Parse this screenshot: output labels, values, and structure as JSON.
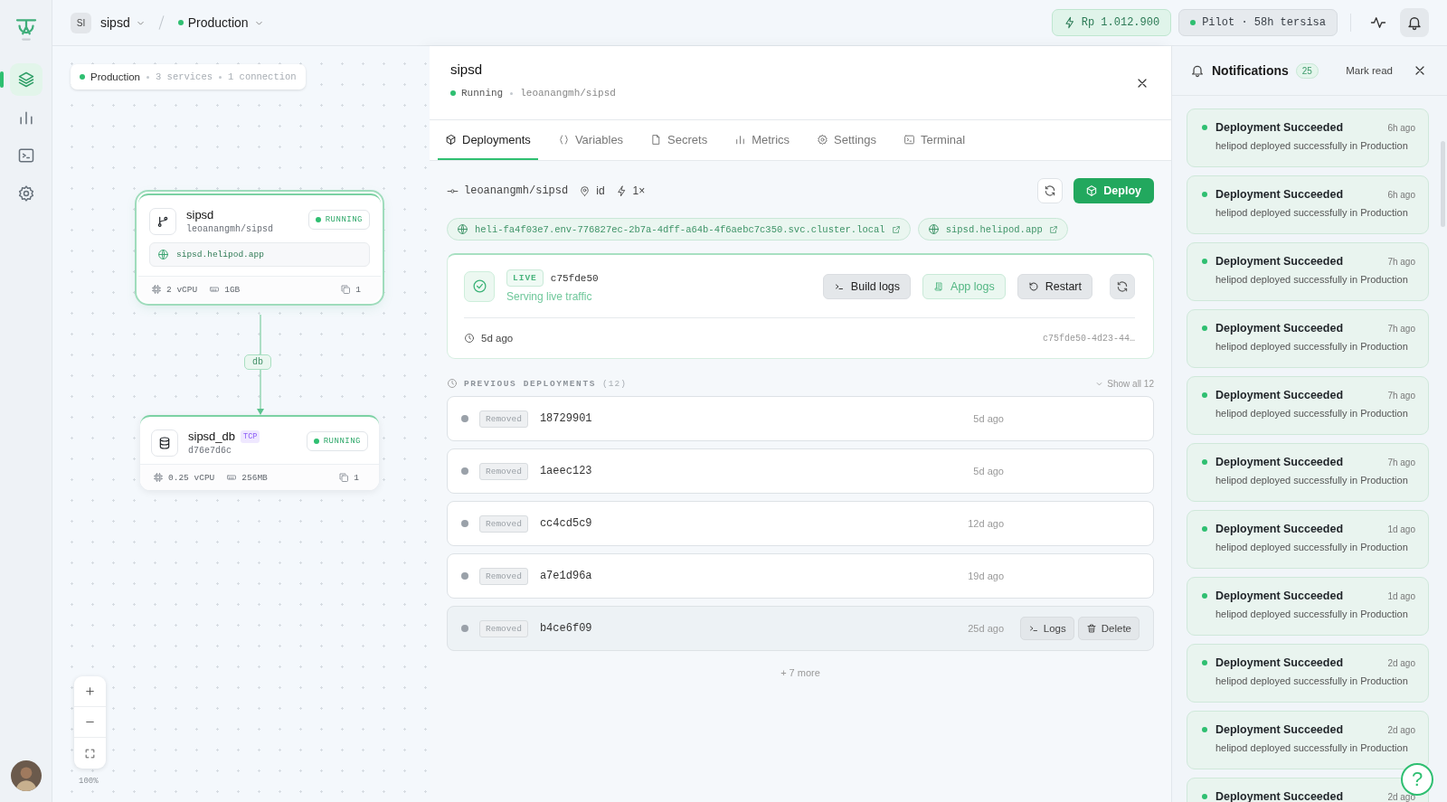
{
  "rail": {
    "items": [
      {
        "kind": "layers",
        "selected": true
      },
      {
        "kind": "chart",
        "selected": false
      },
      {
        "kind": "terminal",
        "selected": false
      },
      {
        "kind": "settings",
        "selected": false
      }
    ]
  },
  "topbar": {
    "project": {
      "initials": "SI",
      "name": "sipsd"
    },
    "environment": {
      "name": "Production"
    },
    "credit": "Rp 1.012.900",
    "plan": "Pilot · 58h tersisa"
  },
  "canvas": {
    "summary": {
      "environment": "Production",
      "services": "3 services",
      "connections": "1 connection"
    },
    "nodes": [
      {
        "kind": "service",
        "name": "sipsd",
        "subtitle": "leoanangmh/sipsd",
        "status": "RUNNING",
        "domain": "sipsd.helipod.app",
        "cpu": "2 vCPU",
        "memory": "1GB",
        "replicas": "1",
        "selected": true
      },
      {
        "kind": "database",
        "name": "sipsd_db",
        "tag": "TCP",
        "subtitle": "d76e7d6c",
        "status": "RUNNING",
        "cpu": "0.25 vCPU",
        "memory": "256MB",
        "replicas": "1",
        "selected": false
      }
    ],
    "edge": {
      "label": "db"
    },
    "zoom_level": "100%"
  },
  "panel": {
    "title": "sipsd",
    "status": "Running",
    "repo": "leoanangmh/sipsd",
    "tabs": [
      {
        "label": "Deployments",
        "kind": "box",
        "selected": true
      },
      {
        "label": "Variables",
        "kind": "braces",
        "selected": false
      },
      {
        "label": "Secrets",
        "kind": "file",
        "selected": false
      },
      {
        "label": "Metrics",
        "kind": "chart",
        "selected": false
      },
      {
        "label": "Settings",
        "kind": "settings",
        "selected": false
      },
      {
        "label": "Terminal",
        "kind": "terminal",
        "selected": false
      }
    ],
    "source": {
      "repo": "leoanangmh/sipsd",
      "region": "id",
      "replicas": "1×"
    },
    "deploy_button": "Deploy",
    "urls": [
      "heli-fa4f03e7.env-776827ec-2b7a-4dff-a64b-4f6aebc7c350.svc.cluster.local",
      "sipsd.helipod.app"
    ],
    "live": {
      "badge": "LIVE",
      "commit": "c75fde50",
      "message": "Serving live traffic",
      "buttons": [
        {
          "label": "Build logs",
          "kind": "terminal"
        },
        {
          "label": "App logs",
          "kind": "scroll"
        },
        {
          "label": "Restart",
          "kind": "restart"
        }
      ],
      "age": "5d ago",
      "id": "c75fde50-4d23-44…"
    },
    "previous": {
      "title": "PREVIOUS DEPLOYMENTS",
      "count": "(12)",
      "show_all": "Show all 12",
      "rows": [
        {
          "status": "Removed",
          "commit": "18729901",
          "age": "5d ago",
          "hovered": false
        },
        {
          "status": "Removed",
          "commit": "1aeec123",
          "age": "5d ago",
          "hovered": false
        },
        {
          "status": "Removed",
          "commit": "cc4cd5c9",
          "age": "12d ago",
          "hovered": false
        },
        {
          "status": "Removed",
          "commit": "a7e1d96a",
          "age": "19d ago",
          "hovered": false
        },
        {
          "status": "Removed",
          "commit": "b4ce6f09",
          "age": "25d ago",
          "hovered": true,
          "actions": [
            "Logs",
            "Delete"
          ]
        }
      ],
      "more": "+ 7 more"
    }
  },
  "notifications": {
    "title": "Notifications",
    "count": "25",
    "mark_read": "Mark read",
    "items": [
      {
        "title": "Deployment Succeeded",
        "time": "6h ago",
        "message": "helipod deployed successfully in Production"
      },
      {
        "title": "Deployment Succeeded",
        "time": "6h ago",
        "message": "helipod deployed successfully in Production"
      },
      {
        "title": "Deployment Succeeded",
        "time": "7h ago",
        "message": "helipod deployed successfully in Production"
      },
      {
        "title": "Deployment Succeeded",
        "time": "7h ago",
        "message": "helipod deployed successfully in Production"
      },
      {
        "title": "Deployment Succeeded",
        "time": "7h ago",
        "message": "helipod deployed successfully in Production"
      },
      {
        "title": "Deployment Succeeded",
        "time": "7h ago",
        "message": "helipod deployed successfully in Production"
      },
      {
        "title": "Deployment Succeeded",
        "time": "1d ago",
        "message": "helipod deployed successfully in Production"
      },
      {
        "title": "Deployment Succeeded",
        "time": "1d ago",
        "message": "helipod deployed successfully in Production"
      },
      {
        "title": "Deployment Succeeded",
        "time": "2d ago",
        "message": "helipod deployed successfully in Production"
      },
      {
        "title": "Deployment Succeeded",
        "time": "2d ago",
        "message": "helipod deployed successfully in Production"
      },
      {
        "title": "Deployment Succeeded",
        "time": "2d ago"
      }
    ]
  },
  "help": "?"
}
